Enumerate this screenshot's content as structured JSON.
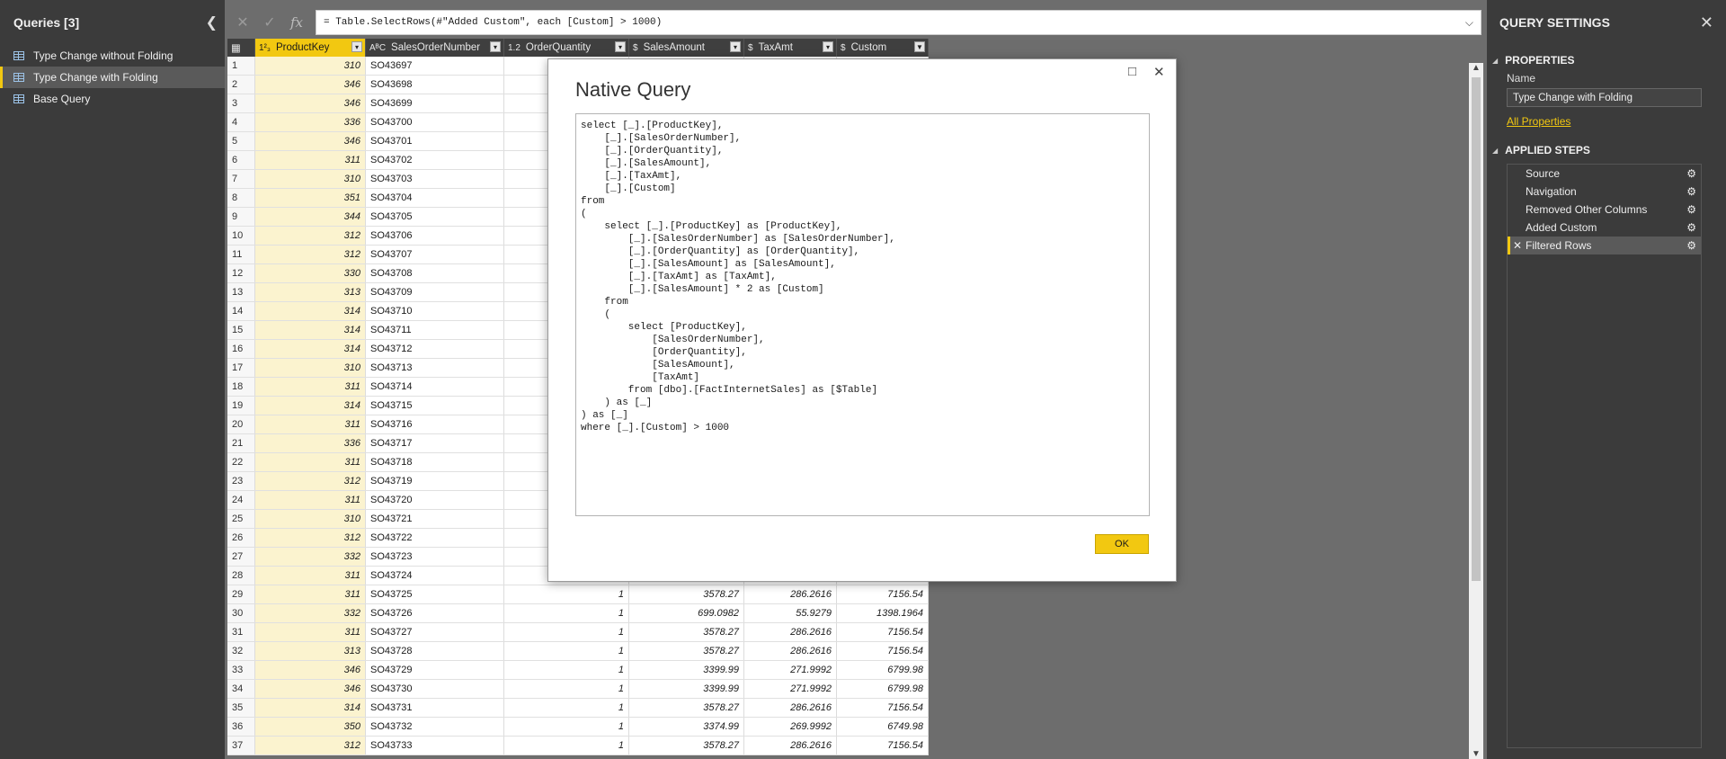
{
  "queries_pane": {
    "title": "Queries [3]",
    "items": [
      {
        "label": "Type Change without Folding"
      },
      {
        "label": "Type Change with Folding"
      },
      {
        "label": "Base Query"
      }
    ]
  },
  "formula_bar": {
    "formula": "= Table.SelectRows(#\"Added Custom\", each [Custom] > 1000)"
  },
  "grid": {
    "columns": [
      {
        "type": "1²₃",
        "label": "ProductKey"
      },
      {
        "type": "AᴮC",
        "label": "SalesOrderNumber"
      },
      {
        "type": "1.2",
        "label": "OrderQuantity"
      },
      {
        "type": "$",
        "label": "SalesAmount"
      },
      {
        "type": "$",
        "label": "TaxAmt"
      },
      {
        "type": "$",
        "label": "Custom"
      }
    ],
    "rows": [
      {
        "idx": "1",
        "key": "310",
        "so": "SO43697",
        "qty": "",
        "amt": "",
        "tax": "",
        "cus": ""
      },
      {
        "idx": "2",
        "key": "346",
        "so": "SO43698",
        "qty": "",
        "amt": "",
        "tax": "",
        "cus": ""
      },
      {
        "idx": "3",
        "key": "346",
        "so": "SO43699",
        "qty": "",
        "amt": "",
        "tax": "",
        "cus": ""
      },
      {
        "idx": "4",
        "key": "336",
        "so": "SO43700",
        "qty": "",
        "amt": "",
        "tax": "",
        "cus": ""
      },
      {
        "idx": "5",
        "key": "346",
        "so": "SO43701",
        "qty": "",
        "amt": "",
        "tax": "",
        "cus": ""
      },
      {
        "idx": "6",
        "key": "311",
        "so": "SO43702",
        "qty": "",
        "amt": "",
        "tax": "",
        "cus": ""
      },
      {
        "idx": "7",
        "key": "310",
        "so": "SO43703",
        "qty": "",
        "amt": "",
        "tax": "",
        "cus": ""
      },
      {
        "idx": "8",
        "key": "351",
        "so": "SO43704",
        "qty": "",
        "amt": "",
        "tax": "",
        "cus": ""
      },
      {
        "idx": "9",
        "key": "344",
        "so": "SO43705",
        "qty": "",
        "amt": "",
        "tax": "",
        "cus": ""
      },
      {
        "idx": "10",
        "key": "312",
        "so": "SO43706",
        "qty": "",
        "amt": "",
        "tax": "",
        "cus": ""
      },
      {
        "idx": "11",
        "key": "312",
        "so": "SO43707",
        "qty": "",
        "amt": "",
        "tax": "",
        "cus": ""
      },
      {
        "idx": "12",
        "key": "330",
        "so": "SO43708",
        "qty": "",
        "amt": "",
        "tax": "",
        "cus": ""
      },
      {
        "idx": "13",
        "key": "313",
        "so": "SO43709",
        "qty": "",
        "amt": "",
        "tax": "",
        "cus": ""
      },
      {
        "idx": "14",
        "key": "314",
        "so": "SO43710",
        "qty": "",
        "amt": "",
        "tax": "",
        "cus": ""
      },
      {
        "idx": "15",
        "key": "314",
        "so": "SO43711",
        "qty": "",
        "amt": "",
        "tax": "",
        "cus": ""
      },
      {
        "idx": "16",
        "key": "314",
        "so": "SO43712",
        "qty": "",
        "amt": "",
        "tax": "",
        "cus": ""
      },
      {
        "idx": "17",
        "key": "310",
        "so": "SO43713",
        "qty": "",
        "amt": "",
        "tax": "",
        "cus": ""
      },
      {
        "idx": "18",
        "key": "311",
        "so": "SO43714",
        "qty": "",
        "amt": "",
        "tax": "",
        "cus": ""
      },
      {
        "idx": "19",
        "key": "314",
        "so": "SO43715",
        "qty": "",
        "amt": "",
        "tax": "",
        "cus": ""
      },
      {
        "idx": "20",
        "key": "311",
        "so": "SO43716",
        "qty": "",
        "amt": "",
        "tax": "",
        "cus": ""
      },
      {
        "idx": "21",
        "key": "336",
        "so": "SO43717",
        "qty": "",
        "amt": "",
        "tax": "",
        "cus": ""
      },
      {
        "idx": "22",
        "key": "311",
        "so": "SO43718",
        "qty": "",
        "amt": "",
        "tax": "",
        "cus": ""
      },
      {
        "idx": "23",
        "key": "312",
        "so": "SO43719",
        "qty": "",
        "amt": "",
        "tax": "",
        "cus": ""
      },
      {
        "idx": "24",
        "key": "311",
        "so": "SO43720",
        "qty": "",
        "amt": "",
        "tax": "",
        "cus": ""
      },
      {
        "idx": "25",
        "key": "310",
        "so": "SO43721",
        "qty": "",
        "amt": "",
        "tax": "",
        "cus": ""
      },
      {
        "idx": "26",
        "key": "312",
        "so": "SO43722",
        "qty": "",
        "amt": "",
        "tax": "",
        "cus": ""
      },
      {
        "idx": "27",
        "key": "332",
        "so": "SO43723",
        "qty": "",
        "amt": "",
        "tax": "",
        "cus": ""
      },
      {
        "idx": "28",
        "key": "311",
        "so": "SO43724",
        "qty": "",
        "amt": "",
        "tax": "",
        "cus": ""
      },
      {
        "idx": "29",
        "key": "311",
        "so": "SO43725",
        "qty": "1",
        "amt": "3578.27",
        "tax": "286.2616",
        "cus": "7156.54"
      },
      {
        "idx": "30",
        "key": "332",
        "so": "SO43726",
        "qty": "1",
        "amt": "699.0982",
        "tax": "55.9279",
        "cus": "1398.1964"
      },
      {
        "idx": "31",
        "key": "311",
        "so": "SO43727",
        "qty": "1",
        "amt": "3578.27",
        "tax": "286.2616",
        "cus": "7156.54"
      },
      {
        "idx": "32",
        "key": "313",
        "so": "SO43728",
        "qty": "1",
        "amt": "3578.27",
        "tax": "286.2616",
        "cus": "7156.54"
      },
      {
        "idx": "33",
        "key": "346",
        "so": "SO43729",
        "qty": "1",
        "amt": "3399.99",
        "tax": "271.9992",
        "cus": "6799.98"
      },
      {
        "idx": "34",
        "key": "346",
        "so": "SO43730",
        "qty": "1",
        "amt": "3399.99",
        "tax": "271.9992",
        "cus": "6799.98"
      },
      {
        "idx": "35",
        "key": "314",
        "so": "SO43731",
        "qty": "1",
        "amt": "3578.27",
        "tax": "286.2616",
        "cus": "7156.54"
      },
      {
        "idx": "36",
        "key": "350",
        "so": "SO43732",
        "qty": "1",
        "amt": "3374.99",
        "tax": "269.9992",
        "cus": "6749.98"
      },
      {
        "idx": "37",
        "key": "312",
        "so": "SO43733",
        "qty": "1",
        "amt": "3578.27",
        "tax": "286.2616",
        "cus": "7156.54"
      }
    ]
  },
  "dialog": {
    "title": "Native Query",
    "sql": "select [_].[ProductKey],\n    [_].[SalesOrderNumber],\n    [_].[OrderQuantity],\n    [_].[SalesAmount],\n    [_].[TaxAmt],\n    [_].[Custom]\nfrom\n(\n    select [_].[ProductKey] as [ProductKey],\n        [_].[SalesOrderNumber] as [SalesOrderNumber],\n        [_].[OrderQuantity] as [OrderQuantity],\n        [_].[SalesAmount] as [SalesAmount],\n        [_].[TaxAmt] as [TaxAmt],\n        [_].[SalesAmount] * 2 as [Custom]\n    from\n    (\n        select [ProductKey],\n            [SalesOrderNumber],\n            [OrderQuantity],\n            [SalesAmount],\n            [TaxAmt]\n        from [dbo].[FactInternetSales] as [$Table]\n    ) as [_]\n) as [_]\nwhere [_].[Custom] > 1000",
    "ok_label": "OK"
  },
  "settings_pane": {
    "title": "QUERY SETTINGS",
    "properties_title": "PROPERTIES",
    "name_label": "Name",
    "name_value": "Type Change with Folding",
    "all_properties": "All Properties",
    "applied_steps_title": "APPLIED STEPS",
    "steps": [
      {
        "label": "Source"
      },
      {
        "label": "Navigation"
      },
      {
        "label": "Removed Other Columns"
      },
      {
        "label": "Added Custom"
      },
      {
        "label": "Filtered Rows"
      }
    ]
  },
  "colors": {
    "accent": "#f2c811",
    "pane_bg": "#3b3b3b",
    "canvas_bg": "#6d6d6d"
  }
}
